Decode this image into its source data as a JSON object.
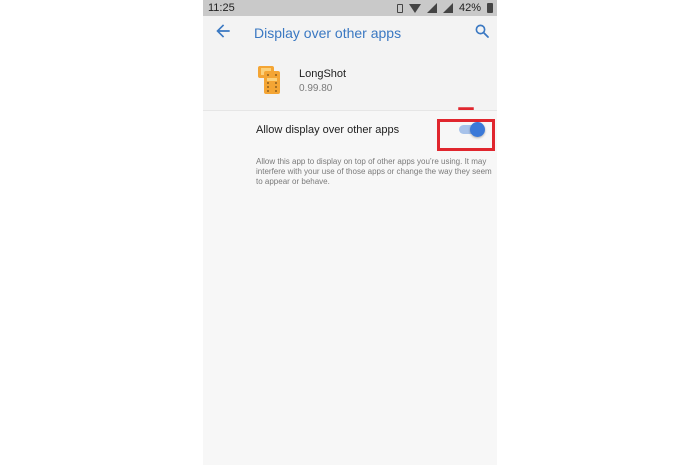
{
  "status_bar": {
    "time": "11:25",
    "battery": "42%"
  },
  "toolbar": {
    "title": "Display over other apps",
    "accent_color": "#3a78c2"
  },
  "app": {
    "name": "LongShot",
    "version": "0.99.80"
  },
  "setting": {
    "label": "Allow display over other apps",
    "enabled": true,
    "description": "Allow this app to display on top of other apps you’re using. It may interfere with your use of those apps or change the way they seem to appear or behave."
  },
  "annotation": {
    "color": "#e0262e"
  }
}
